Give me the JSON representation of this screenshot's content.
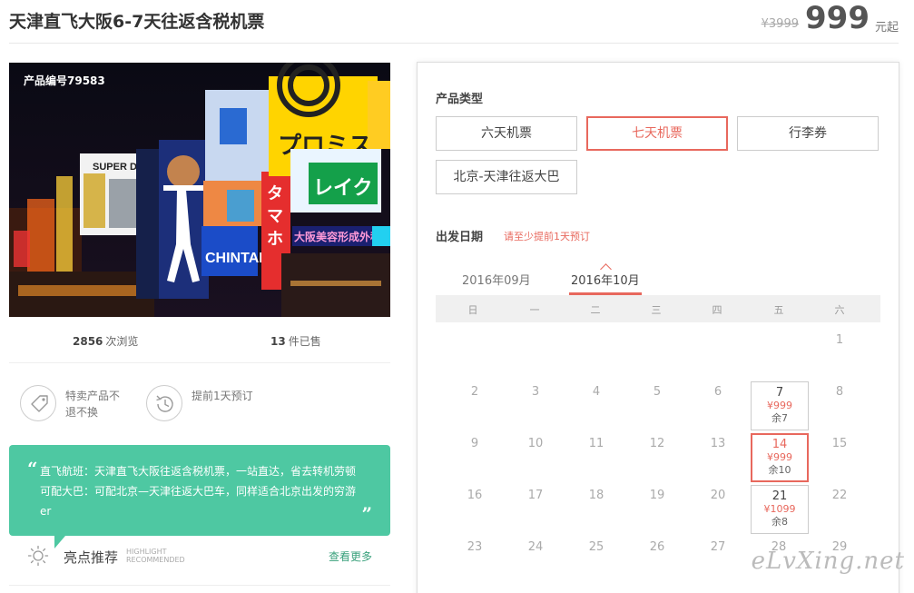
{
  "header": {
    "title": "天津直飞大阪6-7天往返含税机票",
    "original_price": "¥3999",
    "price": "999",
    "price_unit": "元起"
  },
  "hero": {
    "product_id": "产品编号79583"
  },
  "stats": {
    "views_count": "2856",
    "views_label": "次浏览",
    "sold_count": "13",
    "sold_label": "件已售"
  },
  "features": [
    {
      "icon": "tag-icon",
      "text": "特卖产品不退不换"
    },
    {
      "icon": "history-clock-icon",
      "text": "提前1天预订"
    }
  ],
  "bubble": {
    "open_quote": "“",
    "close_quote": "”",
    "lines": [
      "直飞航班：天津直飞大阪往返含税机票，一站直达，省去转机劳顿",
      "可配大巴：可配北京—天津往返大巴车，同样适合北京出发的穷游er"
    ]
  },
  "highlight": {
    "title": "亮点推荐",
    "sub_line1": "HIGHLIGHT",
    "sub_line2": "RECOMMENDED",
    "more": "查看更多"
  },
  "booking": {
    "product_type_label": "产品类型",
    "options": [
      "六天机票",
      "七天机票",
      "行李券",
      "北京-天津往返大巴"
    ],
    "selected_option": "七天机票",
    "date_label": "出发日期",
    "date_hint": "请至少提前1天预订",
    "months": [
      "2016年09月",
      "2016年10月"
    ],
    "active_month": "2016年10月",
    "weekdays": [
      "日",
      "一",
      "二",
      "三",
      "四",
      "五",
      "六"
    ],
    "days": [
      [
        "",
        "",
        "",
        "",
        "",
        "",
        "1"
      ],
      [
        "2",
        "3",
        "4",
        "5",
        "6",
        "7",
        "8"
      ],
      [
        "9",
        "10",
        "11",
        "12",
        "13",
        "14",
        "15"
      ],
      [
        "16",
        "17",
        "18",
        "19",
        "20",
        "21",
        "22"
      ],
      [
        "23",
        "24",
        "25",
        "26",
        "27",
        "28",
        "29"
      ]
    ],
    "available_dates": [
      {
        "day": "7",
        "price": "¥999",
        "remaining": "余7",
        "selected": false
      },
      {
        "day": "14",
        "price": "¥999",
        "remaining": "余10",
        "selected": true
      },
      {
        "day": "21",
        "price": "¥1099",
        "remaining": "余8",
        "selected": false
      }
    ]
  },
  "watermark": "eLvXing.net",
  "colors": {
    "accent": "#e8685d",
    "bubble_green": "#4ec8a2",
    "link_green": "#3aa17c"
  }
}
